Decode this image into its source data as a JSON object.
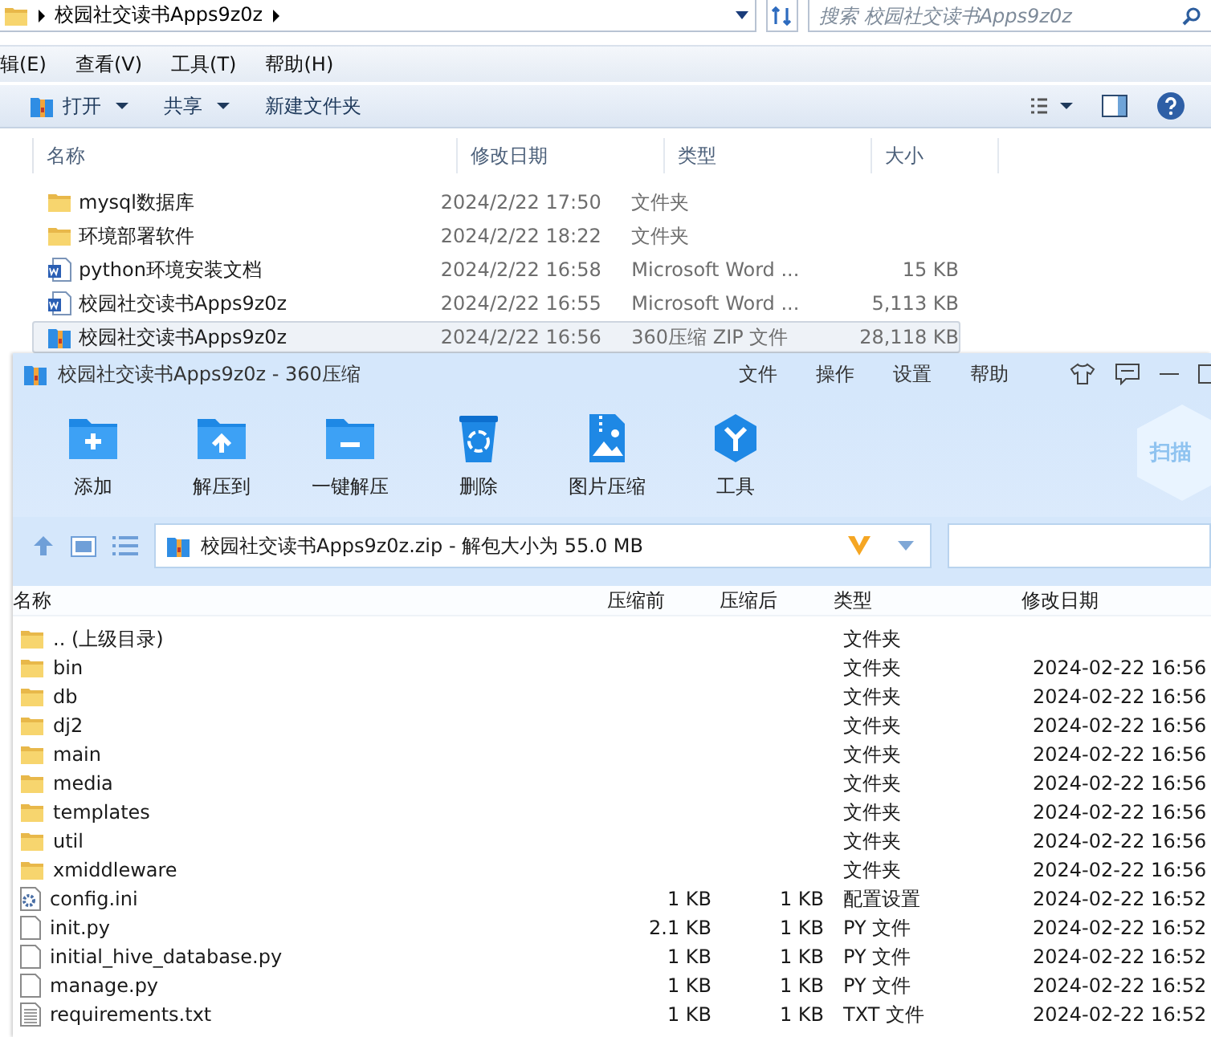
{
  "explorer": {
    "address": "校园社交读书Apps9z0z",
    "search": {
      "placeholder": "搜索 校园社交读书Apps9z0z"
    },
    "menu": [
      "辑(E)",
      "查看(V)",
      "工具(T)",
      "帮助(H)"
    ],
    "toolbar": [
      {
        "label": "打开",
        "kind": "open"
      },
      {
        "label": "共享",
        "kind": "menu"
      },
      {
        "label": "新建文件夹",
        "kind": "plain"
      }
    ],
    "columns": [
      "名称",
      "修改日期",
      "类型",
      "大小"
    ],
    "rows": [
      {
        "kind": "folder",
        "name": "mysql数据库",
        "date": "2024/2/22 17:50",
        "type": "文件夹",
        "selected": false
      },
      {
        "kind": "folder",
        "name": "环境部署软件",
        "date": "2024/2/22 18:22",
        "type": "文件夹",
        "selected": false
      },
      {
        "kind": "word",
        "name": "python环境安装文档",
        "date": "2024/2/22 16:58",
        "type": "Microsoft Word ...",
        "size": "15 KB",
        "selected": false
      },
      {
        "kind": "word",
        "name": "校园社交读书Apps9z0z",
        "date": "2024/2/22 16:55",
        "type": "Microsoft Word ...",
        "size": "5,113 KB",
        "selected": false
      },
      {
        "kind": "zip",
        "name": "校园社交读书Apps9z0z",
        "date": "2024/2/22 16:56",
        "type": "360压缩 ZIP 文件",
        "size": "28,118 KB",
        "selected": true
      }
    ]
  },
  "zip": {
    "title": "校园社交读书Apps9z0z - 360压缩",
    "menu": [
      "文件",
      "操作",
      "设置",
      "帮助"
    ],
    "tools": [
      {
        "label": "添加",
        "kind": "add"
      },
      {
        "label": "解压到",
        "kind": "extract"
      },
      {
        "label": "一键解压",
        "kind": "oneclick"
      },
      {
        "label": "删除",
        "kind": "delete"
      },
      {
        "label": "图片压缩",
        "kind": "image"
      },
      {
        "label": "工具",
        "kind": "tools"
      }
    ],
    "scan": "扫描",
    "path": "校园社交读书Apps9z0z.zip - 解包大小为 55.0 MB",
    "columns": [
      "名称",
      "压缩前",
      "压缩后",
      "类型",
      "修改日期"
    ],
    "rows": [
      {
        "kind": "folder",
        "name": ".. (上级目录)",
        "type": "文件夹"
      },
      {
        "kind": "folder",
        "name": "bin",
        "type": "文件夹",
        "date": "2024-02-22 16:56"
      },
      {
        "kind": "folder",
        "name": "db",
        "type": "文件夹",
        "date": "2024-02-22 16:56"
      },
      {
        "kind": "folder",
        "name": "dj2",
        "type": "文件夹",
        "date": "2024-02-22 16:56"
      },
      {
        "kind": "folder",
        "name": "main",
        "type": "文件夹",
        "date": "2024-02-22 16:56"
      },
      {
        "kind": "folder",
        "name": "media",
        "type": "文件夹",
        "date": "2024-02-22 16:56"
      },
      {
        "kind": "folder",
        "name": "templates",
        "type": "文件夹",
        "date": "2024-02-22 16:56"
      },
      {
        "kind": "folder",
        "name": "util",
        "type": "文件夹",
        "date": "2024-02-22 16:56"
      },
      {
        "kind": "folder",
        "name": "xmiddleware",
        "type": "文件夹",
        "date": "2024-02-22 16:56"
      },
      {
        "kind": "config",
        "name": "config.ini",
        "before": "1 KB",
        "after": "1 KB",
        "type": "配置设置",
        "date": "2024-02-22 16:52"
      },
      {
        "kind": "file",
        "name": "init.py",
        "before": "2.1 KB",
        "after": "1 KB",
        "type": "PY 文件",
        "date": "2024-02-22 16:52"
      },
      {
        "kind": "file",
        "name": "initial_hive_database.py",
        "before": "1 KB",
        "after": "1 KB",
        "type": "PY 文件",
        "date": "2024-02-22 16:52"
      },
      {
        "kind": "file",
        "name": "manage.py",
        "before": "1 KB",
        "after": "1 KB",
        "type": "PY 文件",
        "date": "2024-02-22 16:52"
      },
      {
        "kind": "text",
        "name": "requirements.txt",
        "before": "1 KB",
        "after": "1 KB",
        "type": "TXT 文件",
        "date": "2024-02-22 16:52"
      }
    ]
  }
}
